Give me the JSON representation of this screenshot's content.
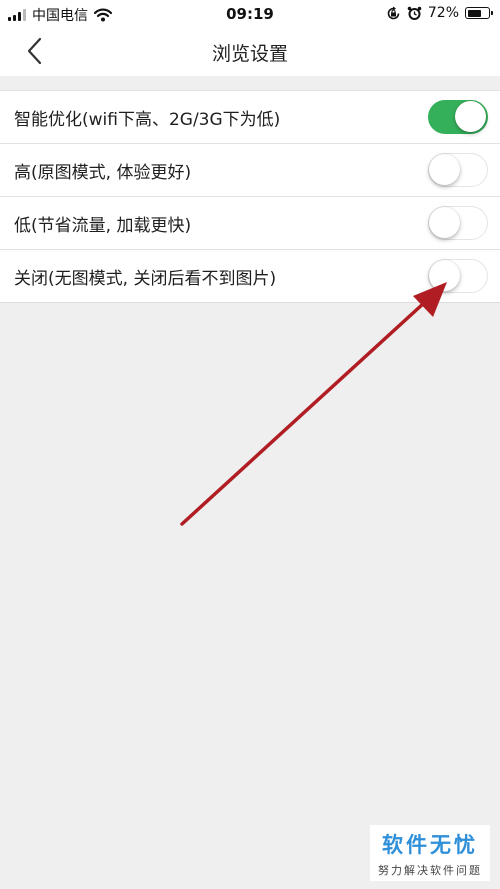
{
  "status_bar": {
    "carrier": "中国电信",
    "time": "09:19",
    "battery_text": "72%",
    "battery_level": 0.72,
    "icons": [
      "signal-icon",
      "wifi-icon",
      "orientation-lock-icon",
      "alarm-icon",
      "battery-icon"
    ]
  },
  "nav": {
    "title": "浏览设置",
    "back_icon": "chevron-left-icon"
  },
  "options": [
    {
      "label": "智能优化(wifi下高、2G/3G下为低)",
      "on": true
    },
    {
      "label": "高(原图模式, 体验更好)",
      "on": false
    },
    {
      "label": "低(节省流量, 加载更快)",
      "on": false
    },
    {
      "label": "关闭(无图模式, 关闭后看不到图片)",
      "on": false
    }
  ],
  "annotation": {
    "color": "#b01e24",
    "icon": "red-arrow-annotation"
  },
  "watermark": {
    "title": "软件无忧",
    "subtitle": "努力解决软件问题"
  },
  "colors": {
    "toggle_on": "#35b05a",
    "background": "#efefef"
  }
}
